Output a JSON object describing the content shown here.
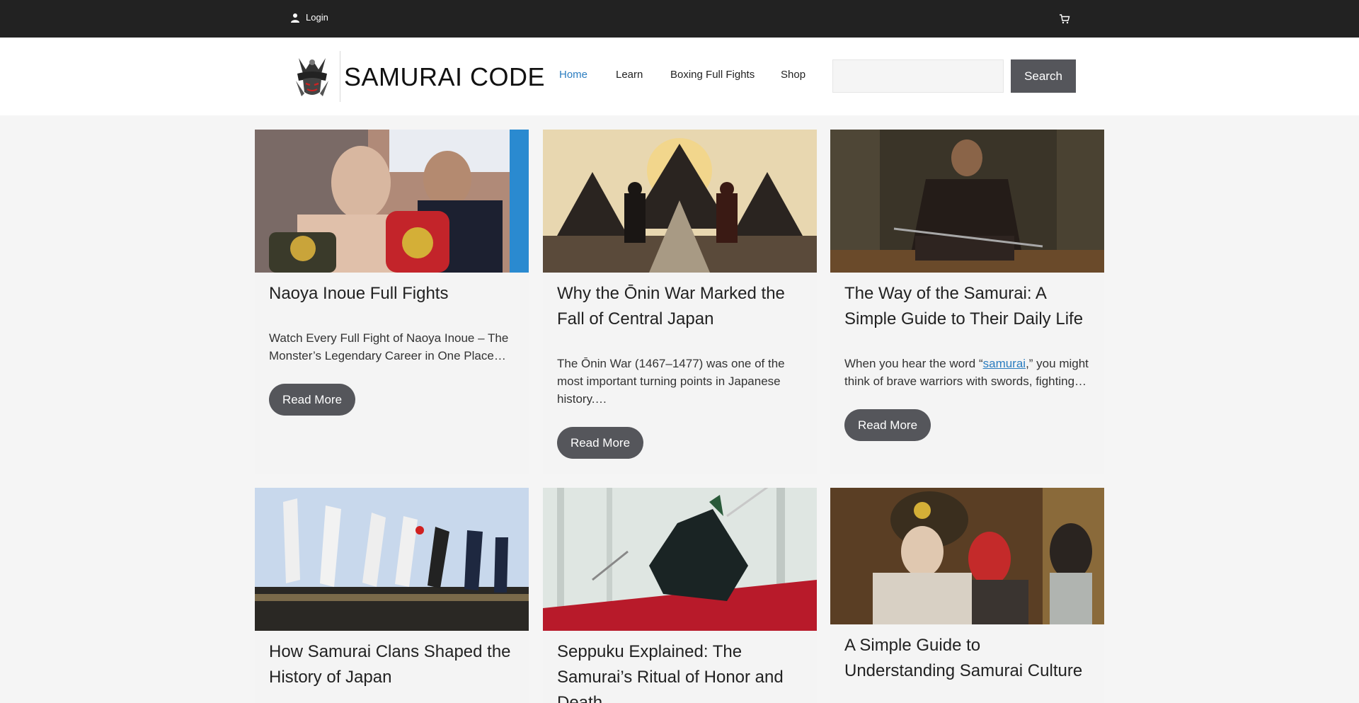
{
  "topbar": {
    "login_label": "Login"
  },
  "header": {
    "brand": "SAMURAI CODE",
    "nav": [
      {
        "label": "Home",
        "active": true
      },
      {
        "label": "Learn"
      },
      {
        "label": "Boxing Full Fights"
      },
      {
        "label": "Shop"
      }
    ],
    "search": {
      "value": "",
      "button_label": "Search"
    }
  },
  "posts": [
    {
      "title": "Naoya Inoue Full Fights",
      "excerpt": "Watch Every Full Fight of Naoya Inoue – The Monster’s Legendary Career in One Place…",
      "button": "Read More"
    },
    {
      "title": "Why the Ōnin War Marked the Fall of Central Japan",
      "excerpt": "The Ōnin War (1467–1477) was one of the most important turning points in Japanese history.…",
      "button": "Read More"
    },
    {
      "title": "The Way of the Samurai: A Simple Guide to Their Daily Life",
      "excerpt_before": "When you hear the word “",
      "excerpt_link": "samurai",
      "excerpt_after": ",” you might think of brave warriors with swords, fighting…",
      "button": "Read More"
    },
    {
      "title": "How Samurai Clans Shaped the History of Japan"
    },
    {
      "title": "Seppuku Explained: The Samurai’s Ritual of Honor and Death"
    },
    {
      "title": "A Simple Guide to Understanding Samurai Culture"
    }
  ],
  "colors": {
    "topbar": "#222222",
    "accent_link": "#2b7dc0",
    "button": "#55565b",
    "card_bg": "#f4f4f4"
  }
}
